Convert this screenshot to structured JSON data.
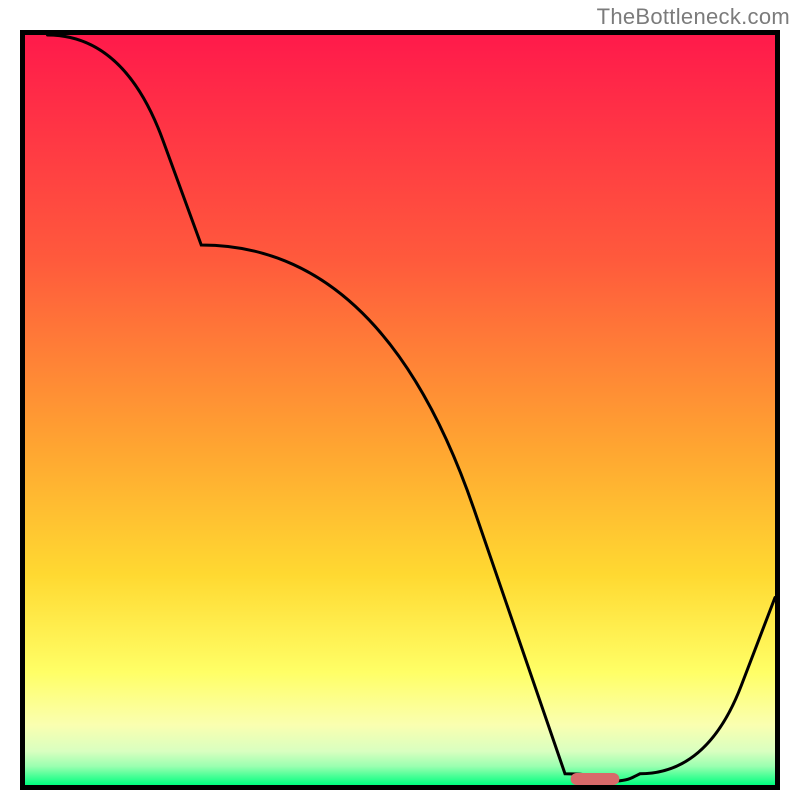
{
  "attribution": "TheBottleneck.com",
  "chart_data": {
    "type": "line",
    "title": "",
    "xlabel": "",
    "ylabel": "",
    "xlim": [
      0,
      100
    ],
    "ylim": [
      0,
      100
    ],
    "grid": false,
    "legend": false,
    "gradient_stops": [
      {
        "offset": 0,
        "color": "#ff1a4b"
      },
      {
        "offset": 0.3,
        "color": "#ff5a3c"
      },
      {
        "offset": 0.55,
        "color": "#ffa531"
      },
      {
        "offset": 0.72,
        "color": "#ffd931"
      },
      {
        "offset": 0.85,
        "color": "#ffff66"
      },
      {
        "offset": 0.92,
        "color": "#faffb0"
      },
      {
        "offset": 0.955,
        "color": "#d9ffc0"
      },
      {
        "offset": 0.975,
        "color": "#9bffb0"
      },
      {
        "offset": 1.0,
        "color": "#00ff7f"
      }
    ],
    "curve": {
      "x": [
        3,
        23.5,
        72,
        78,
        82,
        100
      ],
      "y": [
        100,
        72,
        1.5,
        0.5,
        1.5,
        25
      ]
    },
    "marker": {
      "x_center": 76,
      "y_center": 0.8,
      "width": 6.5,
      "height": 1.6,
      "color": "#d86a6a"
    },
    "frame_color": "#000000",
    "frame_width": 5,
    "line_color": "#000000",
    "line_width": 3
  }
}
